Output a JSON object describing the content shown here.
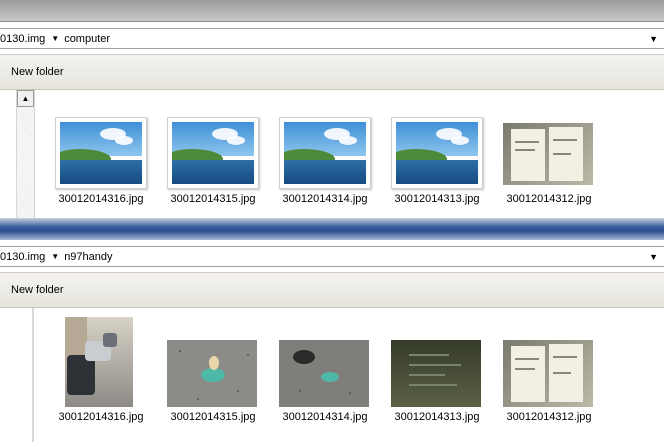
{
  "pane_top": {
    "address": {
      "parent": "0130.img",
      "current": "computer"
    },
    "toolbar": {
      "new_folder": "New folder"
    },
    "files": [
      {
        "name": "30012014316.jpg",
        "thumb": "landscape"
      },
      {
        "name": "30012014315.jpg",
        "thumb": "landscape"
      },
      {
        "name": "30012014314.jpg",
        "thumb": "landscape"
      },
      {
        "name": "30012014313.jpg",
        "thumb": "landscape"
      },
      {
        "name": "30012014312.jpg",
        "thumb": "document-photo"
      }
    ]
  },
  "pane_bottom": {
    "address": {
      "parent": "0130.img",
      "current": "n97handy"
    },
    "toolbar": {
      "new_folder": "New folder"
    },
    "files": [
      {
        "name": "30012014316.jpg",
        "thumb": "street-photo"
      },
      {
        "name": "30012014315.jpg",
        "thumb": "pacifier-photo"
      },
      {
        "name": "30012014314.jpg",
        "thumb": "pacifier-photo"
      },
      {
        "name": "30012014313.jpg",
        "thumb": "dark-document-photo"
      },
      {
        "name": "30012014312.jpg",
        "thumb": "document-photo"
      }
    ]
  }
}
